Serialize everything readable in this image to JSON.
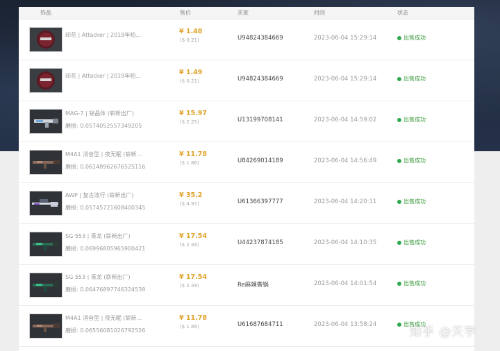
{
  "header": {
    "item": "饰品",
    "price": "售价",
    "buyer": "买家",
    "time": "时间",
    "status": "状态"
  },
  "rows": [
    {
      "name": "印花 | Attacker | 2019年柏...",
      "wear": "",
      "price": "¥ 1.48",
      "usd": "($ 0.21)",
      "buyer": "U94824384669",
      "time": "2023-06-04 15:29:14",
      "status": "出售成功",
      "icon": "sticker-capsule-icon"
    },
    {
      "name": "印花 | Attacker | 2019年柏...",
      "wear": "",
      "price": "¥ 1.49",
      "usd": "($ 0.21)",
      "buyer": "U94824384669",
      "time": "2023-06-04 15:29:14",
      "status": "出售成功",
      "icon": "sticker-capsule-icon"
    },
    {
      "name": "MAG-7 | 铋晶体 (崭新出厂)",
      "wear": "磨损: 0.0574052557349205",
      "price": "¥ 15.97",
      "usd": "($ 2.25)",
      "buyer": "U13199708141",
      "time": "2023-06-04 14:59:02",
      "status": "出售成功",
      "icon": "shotgun-icon"
    },
    {
      "name": "M4A1 消音型 | 夜无眠 (崭新...",
      "wear": "磨损: 0.06148962676525116",
      "price": "¥ 11.78",
      "usd": "($ 1.66)",
      "buyer": "U84269014189",
      "time": "2023-06-04 14:56:49",
      "status": "出售成功",
      "icon": "rifle-icon"
    },
    {
      "name": "AWP | 复古流行 (崭新出厂)",
      "wear": "磨损: 0.05745721608400345",
      "price": "¥ 35.2",
      "usd": "($ 4.97)",
      "buyer": "U61366397777",
      "time": "2023-06-04 14:20:11",
      "status": "出售成功",
      "icon": "sniper-rifle-icon"
    },
    {
      "name": "SG 553 | 青龙 (崭新出厂)",
      "wear": "磨损: 0.06996805965900421",
      "price": "¥ 17.54",
      "usd": "($ 2.48)",
      "buyer": "U44237874185",
      "time": "2023-06-04 14:10:35",
      "status": "出售成功",
      "icon": "rifle-icon"
    },
    {
      "name": "SG 553 | 青龙 (崭新出厂)",
      "wear": "磨损: 0.06476897746324539",
      "price": "¥ 17.54",
      "usd": "($ 2.48)",
      "buyer": "Re麻辣香锅",
      "time": "2023-06-04 14:01:54",
      "status": "出售成功",
      "icon": "rifle-icon"
    },
    {
      "name": "M4A1 消音型 | 夜无眠 (崭新...",
      "wear": "磨损: 0.06556081026792526",
      "price": "¥ 11.78",
      "usd": "($ 1.66)",
      "buyer": "U61687684711",
      "time": "2023-06-04 13:58:24",
      "status": "出售成功",
      "icon": "rifle-icon"
    }
  ],
  "watermark": "知乎 @天宇",
  "colors": {
    "price": "#e0a32a",
    "status": "#2fa84f",
    "background_dark": "#1f2b3d"
  }
}
